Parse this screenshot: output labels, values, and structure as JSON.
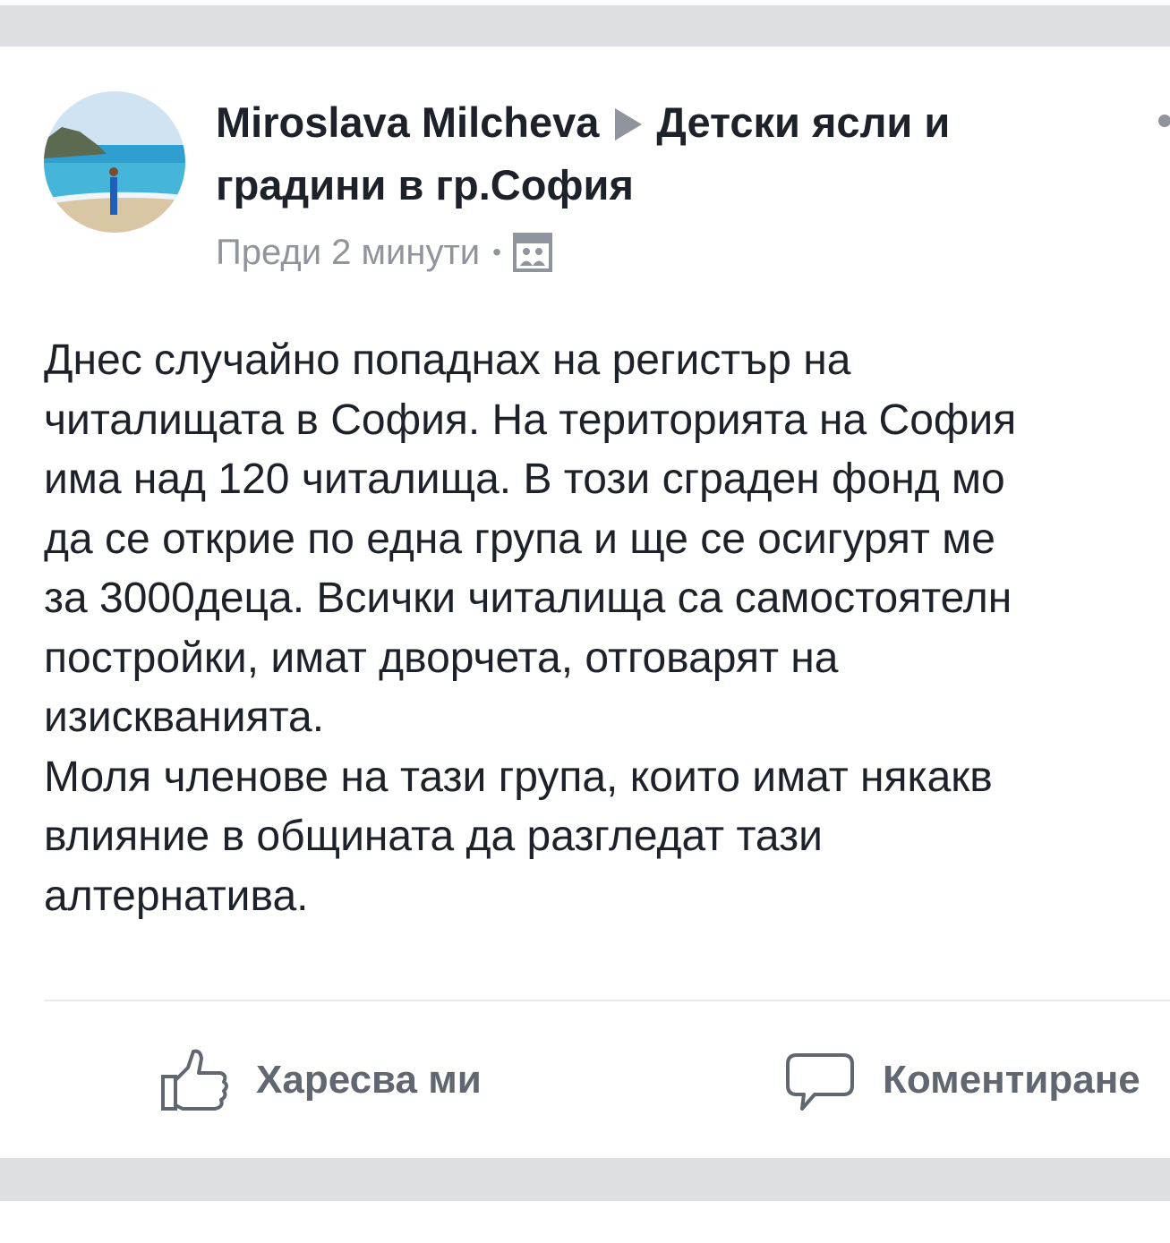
{
  "post": {
    "author": "Miroslava Milcheva",
    "group_line1": "Детски ясли и",
    "group_line2": "градини в гр.София",
    "timestamp": "Преди 2 минути",
    "separator": "•",
    "audience_icon": "group-icon",
    "body_lines": [
      "Днес случайно попаднах на регистър на",
      "читалищата в София. На територията на София",
      "има над 120 читалища. В този сграден фонд мо",
      "да се открие по една група и ще се осигурят ме",
      "за 3000деца. Всички читалища са самостоятелн",
      "постройки, имат дворчета, отговарят на",
      "изискванията.",
      "Моля членове на тази група, които имат някакв",
      "влияние в общината да разгледат тази",
      "алтернатива."
    ]
  },
  "actions": {
    "like_label": "Харесва ми",
    "comment_label": "Коментиране"
  },
  "colors": {
    "text": "#1d2129",
    "secondary": "#90949c",
    "action": "#606770",
    "separator_band": "#dddfe2"
  }
}
